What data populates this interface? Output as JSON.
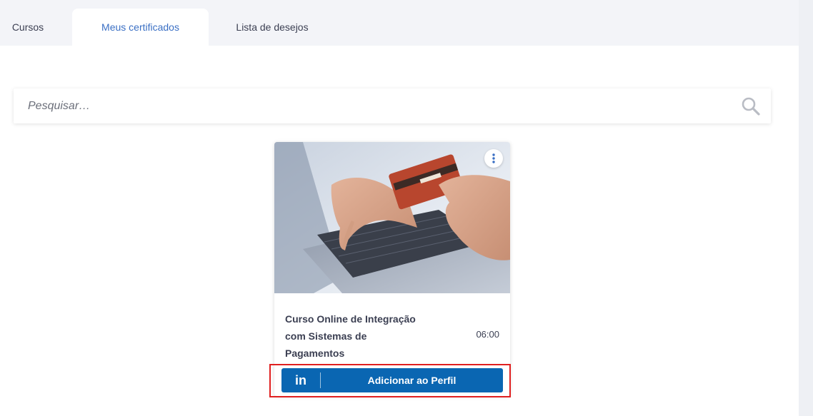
{
  "tabs": [
    {
      "label": "Cursos",
      "active": false
    },
    {
      "label": "Meus certificados",
      "active": true
    },
    {
      "label": "Lista de desejos",
      "active": false
    }
  ],
  "search": {
    "placeholder": "Pesquisar…",
    "icon": "search-icon"
  },
  "card": {
    "title": "Curso Online de Integração com Sistemas de Pagamentos",
    "duration": "06:00",
    "menu_icon": "kebab-menu-icon",
    "linkedin": {
      "logo_text": "in",
      "label": "Adicionar ao Perfil",
      "color": "#0a66b2"
    }
  },
  "colors": {
    "accent": "#3a6fc4",
    "highlight": "#e02020",
    "linkedin": "#0a66b2"
  }
}
